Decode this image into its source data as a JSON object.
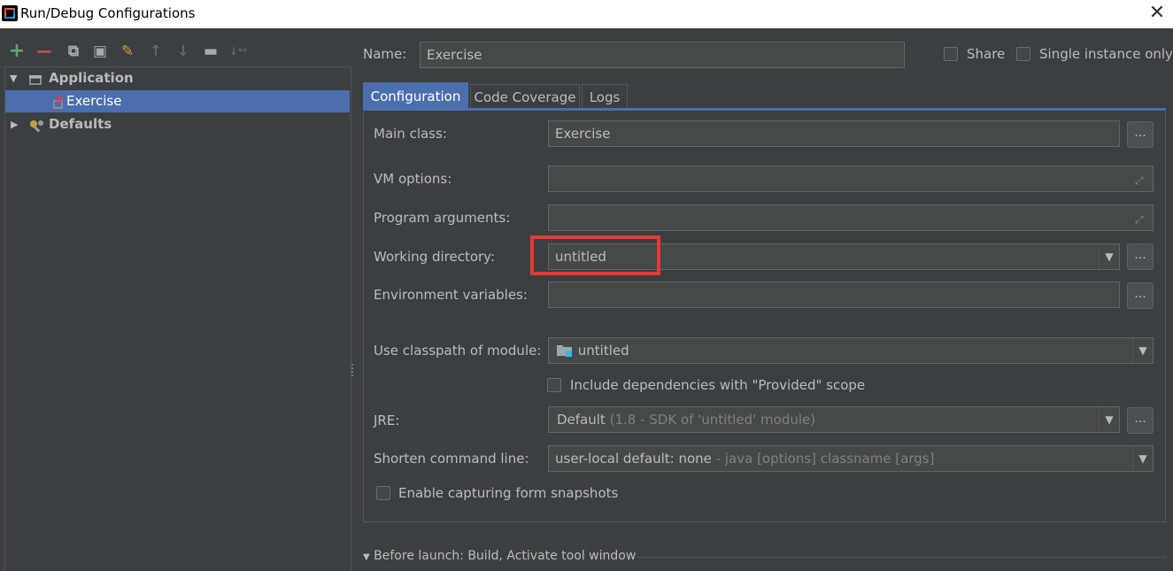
{
  "window": {
    "title": "Run/Debug Configurations",
    "close_glyph": "✕"
  },
  "toolbar": {
    "add": "+",
    "remove": "—",
    "copy": "⧉",
    "save": "▣",
    "edit": "✎",
    "up": "↑",
    "down": "↓",
    "folder": "▬",
    "sort": "↓ᵃᶻ"
  },
  "tree": {
    "expanded_glyph": "▼",
    "collapsed_glyph": "▶",
    "items": [
      {
        "label": "Application",
        "icon": "application-icon",
        "expanded": true
      },
      {
        "label": "Exercise",
        "icon": "run-config-error-icon",
        "selected": true
      },
      {
        "label": "Defaults",
        "icon": "defaults-wrench-icon",
        "expanded": false
      }
    ]
  },
  "header": {
    "name_label": "Name:",
    "name_value": "Exercise",
    "share_label": "Share",
    "single_instance_label": "Single instance only"
  },
  "tabs": [
    {
      "label": "Configuration",
      "active": true
    },
    {
      "label": "Code Coverage",
      "active": false
    },
    {
      "label": "Logs",
      "active": false
    }
  ],
  "form": {
    "main_class_label": "Main class:",
    "main_class_value": "Exercise",
    "vm_options_label": "VM options:",
    "vm_options_value": "",
    "program_args_label": "Program arguments:",
    "program_args_value": "",
    "working_dir_label": "Working directory:",
    "working_dir_value": "untitled",
    "env_vars_label": "Environment variables:",
    "env_vars_value": "",
    "classpath_label": "Use classpath of module:",
    "classpath_value": "untitled",
    "include_deps_label": "Include dependencies with \"Provided\" scope",
    "jre_label": "JRE:",
    "jre_value": "Default",
    "jre_detail": "(1.8 - SDK of 'untitled' module)",
    "shorten_label": "Shorten command line:",
    "shorten_value": "user-local default: none",
    "shorten_detail": "- java [options] classname [args]",
    "snapshots_label": "Enable capturing form snapshots",
    "more_glyph": "...",
    "dropdown_glyph": "▼",
    "expand_glyph": "⤢"
  },
  "before_launch": {
    "arrow": "▼",
    "label": "Before launch: Build, Activate tool window"
  },
  "colors": {
    "background": "#3c3f41",
    "selection": "#4b6eaf",
    "add_green": "#59a869",
    "remove_red": "#e05555",
    "highlight_red": "#e53935"
  }
}
